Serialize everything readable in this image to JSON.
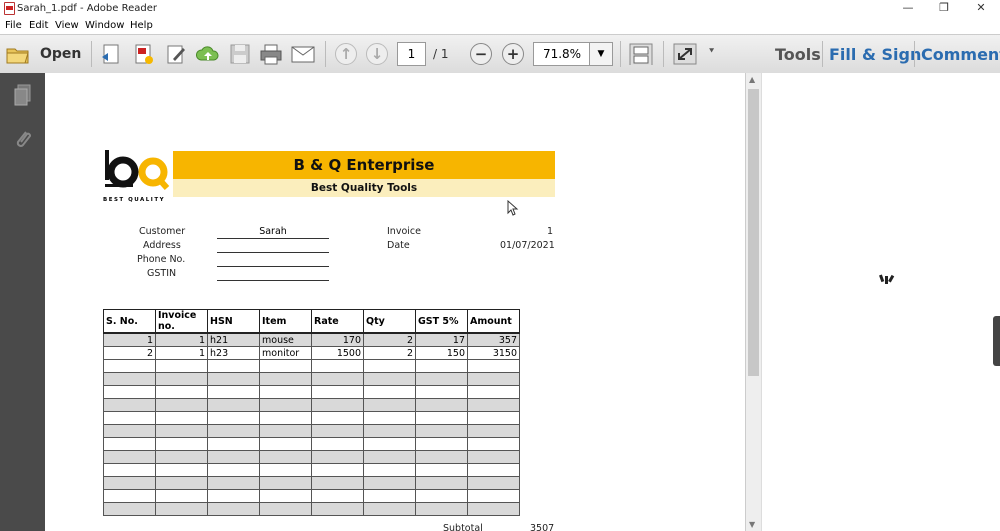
{
  "window": {
    "title": "Sarah_1.pdf - Adobe Reader",
    "controls": [
      "—",
      "❐",
      "✕"
    ]
  },
  "menu": [
    "File",
    "Edit",
    "View",
    "Window",
    "Help"
  ],
  "toolbar": {
    "open_label": "Open",
    "page_current": "1",
    "page_total": "/ 1",
    "zoom": "71.8%",
    "tools_label": "Tools",
    "fill_sign_label": "Fill & Sign",
    "comment_label": "Comment"
  },
  "document": {
    "logo_tagline": "BEST QUALITY",
    "company_name": "B & Q Enterprise",
    "company_tagline": "Best Quality Tools",
    "fields": {
      "customer_label": "Customer",
      "customer_value": "Sarah",
      "address_label": "Address",
      "address_value": "",
      "phone_label": "Phone No.",
      "phone_value": "",
      "gstin_label": "GSTIN",
      "gstin_value": "",
      "invoice_label": "Invoice",
      "invoice_value": "1",
      "date_label": "Date",
      "date_value": "01/07/2021"
    },
    "table": {
      "headers": [
        "S. No.",
        "Invoice no.",
        "HSN",
        "Item",
        "Rate",
        "Qty",
        "GST 5%",
        "Amount"
      ],
      "rows": [
        [
          "1",
          "1",
          "h21",
          "mouse",
          "170",
          "2",
          "17",
          "357"
        ],
        [
          "2",
          "1",
          "h23",
          "monitor",
          "1500",
          "2",
          "150",
          "3150"
        ]
      ],
      "empty_rows": 12
    },
    "subtotal_label": "Subtotal",
    "subtotal_value": "3507"
  },
  "colors": {
    "banner": "#f7b500",
    "subbanner": "#fbeebd",
    "accent_blue": "#2b6cb0",
    "left_panel": "#4a4a4a"
  }
}
